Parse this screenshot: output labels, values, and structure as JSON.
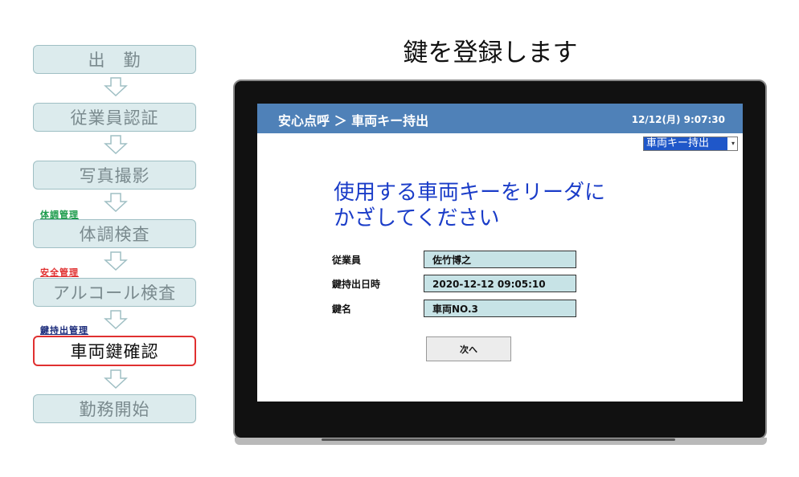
{
  "headline": "鍵を登録します",
  "flow": {
    "steps": [
      "出　勤",
      "従業員認証",
      "写真撮影",
      "体調検査",
      "アルコール検査",
      "車両鍵確認",
      "勤務開始"
    ],
    "active_step": "車両鍵確認",
    "tags": [
      {
        "label": "体調管理",
        "color": "#1a9a4a"
      },
      {
        "label": "安全管理",
        "color": "#e03030"
      },
      {
        "label": "鍵持出管理",
        "color": "#1a2a7a"
      }
    ]
  },
  "app": {
    "breadcrumb": "安心点呼 ＞ 車両キー持出",
    "datetime": "12/12(月)  9:07:30",
    "mode_select": "車両キー持出",
    "message_line1": "使用する車両キーをリーダに",
    "message_line2": "かざしてください",
    "fields": {
      "employee_label": "従業員",
      "employee_value": "佐竹博之",
      "checkout_label": "鍵持出日時",
      "checkout_value": "2020-12-12  09:05:10",
      "key_label": "鍵名",
      "key_value": "車両NO.3"
    },
    "next_label": "次へ"
  },
  "colors": {
    "header_bar": "#4f81b8",
    "message_text": "#1a3cc8",
    "field_bg": "#c7e3e6",
    "active_border": "#e03030"
  }
}
